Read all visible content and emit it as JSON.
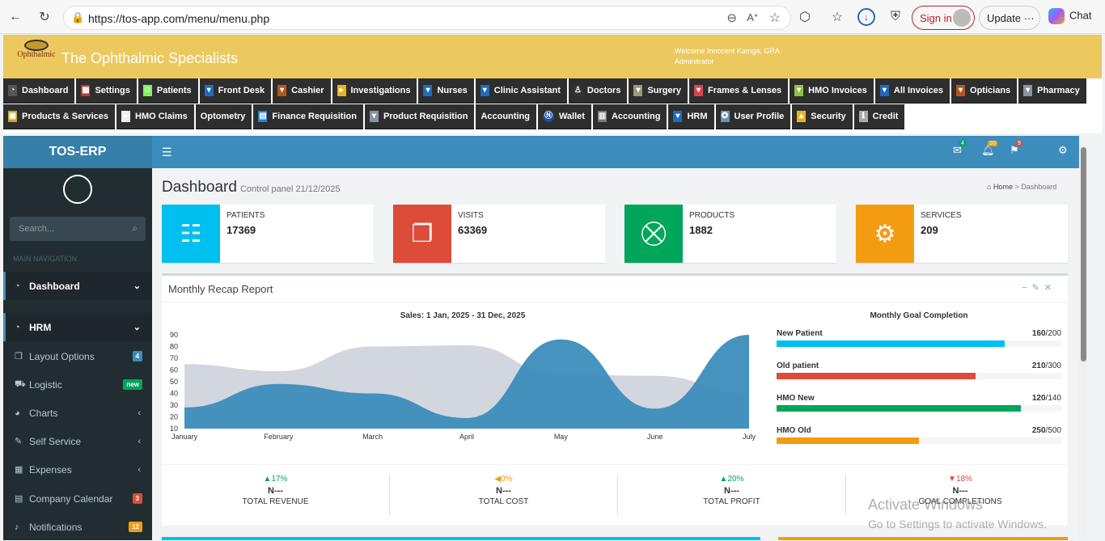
{
  "browser": {
    "url": "https://tos-app.com/menu/menu.php",
    "sign_in": "Sign in",
    "update": "Update",
    "chat": "Chat"
  },
  "header": {
    "clinic_name": "The Ophthalmic Specialists",
    "logo_line1": "The",
    "logo_line2": "Ophthalmic",
    "logo_line3": "Specialists",
    "welcome": "Welcome Innocent Kamga, GRA",
    "role": "Adminitrator"
  },
  "menu_row1": [
    {
      "label": "Dashboard",
      "icon": "tachometer-icon",
      "color": "#555"
    },
    {
      "label": "Settings",
      "icon": "grid-icon",
      "color": "#c0392b"
    },
    {
      "label": "Patients",
      "icon": "users-icon",
      "color": "#8e6"
    },
    {
      "label": "Front Desk",
      "icon": "dropdown-icon",
      "color": "#1e6bbf"
    },
    {
      "label": "Cashier",
      "icon": "dropdown-icon",
      "color": "#b5561f"
    },
    {
      "label": "Investigations",
      "icon": "play-icon",
      "color": "#e6b422"
    },
    {
      "label": "Nurses",
      "icon": "dropdown-icon",
      "color": "#1e6bbf"
    },
    {
      "label": "Clinic Assistant",
      "icon": "dropdown-icon",
      "color": "#1e6bbf"
    },
    {
      "label": "Doctors",
      "icon": "doctor-icon",
      "color": "#333"
    },
    {
      "label": "Surgery",
      "icon": "dropdown-icon",
      "color": "#9a9a7a"
    },
    {
      "label": "Frames & Lenses",
      "icon": "dropdown-icon",
      "color": "#d9434f"
    },
    {
      "label": "HMO Invoices",
      "icon": "dropdown-icon",
      "color": "#8bc34a"
    },
    {
      "label": "All Invoices",
      "icon": "dropdown-icon",
      "color": "#1e6bbf"
    },
    {
      "label": "Opticians",
      "icon": "dropdown-icon",
      "color": "#b5561f"
    },
    {
      "label": "Pharmacy",
      "icon": "dropdown-icon",
      "color": "#8a93a5"
    }
  ],
  "menu_row2": [
    {
      "label": "Products & Services",
      "icon": "box-icon",
      "color": "#c9a227"
    },
    {
      "label": "HMO Claims",
      "icon": "play-icon",
      "color": "#eee"
    },
    {
      "label": "Optometry",
      "icon": "",
      "color": ""
    },
    {
      "label": "Finance Requisition",
      "icon": "finance-icon",
      "color": "#2d7dd2"
    },
    {
      "label": "Product Requisition",
      "icon": "dropdown-icon",
      "color": "#8a93a5"
    },
    {
      "label": "Accounting",
      "icon": "",
      "color": ""
    },
    {
      "label": "Wallet",
      "icon": "wallet-icon",
      "color": "#1e4fa0"
    },
    {
      "label": "Accounting",
      "icon": "ledger-icon",
      "color": "#777"
    },
    {
      "label": "HRM",
      "icon": "dropdown-icon",
      "color": "#1e6bbf"
    },
    {
      "label": "User Profile",
      "icon": "user-profile-icon",
      "color": "#6b8fbf"
    },
    {
      "label": "Security",
      "icon": "lock-icon",
      "color": "#e6b422"
    },
    {
      "label": "Credit",
      "icon": "info-icon",
      "color": "#aaa"
    }
  ],
  "sidebar": {
    "brand": "TOS-ERP",
    "search_placeholder": "Search...",
    "section": "MAIN NAVIGATION",
    "items": [
      {
        "label": "Dashboard",
        "badge": ""
      },
      {
        "label": "HRM",
        "badge": ""
      },
      {
        "label": "Layout Options",
        "badge": "4"
      },
      {
        "label": "Logistic",
        "badge": "new"
      },
      {
        "label": "Charts",
        "badge": ""
      },
      {
        "label": "Self Service",
        "badge": ""
      },
      {
        "label": "Expenses",
        "badge": ""
      },
      {
        "label": "Company Calendar",
        "badge": "3"
      },
      {
        "label": "Notifications",
        "badge": "12"
      }
    ]
  },
  "topnav": {
    "mail_count": "4",
    "bell_count": "10",
    "flag_count": "9"
  },
  "page": {
    "title": "Dashboard",
    "subtitle": "Control panel 21/12/2025",
    "crumb_home": "Home",
    "crumb_current": "Dashboard"
  },
  "infoboxes": [
    {
      "label": "PATIENTS",
      "value": "17369",
      "color": "#00c0ef",
      "icon": "patients-icon"
    },
    {
      "label": "VISITS",
      "value": "63369",
      "color": "#dd4b39",
      "icon": "files-icon"
    },
    {
      "label": "PRODUCTS",
      "value": "1882",
      "color": "#00a65a",
      "icon": "cart-icon"
    },
    {
      "label": "SERVICES",
      "value": "209",
      "color": "#f39c12",
      "icon": "gear-icon"
    }
  ],
  "recap": {
    "title": "Monthly Recap Report",
    "sales_title": "Sales: 1 Jan, 2025 - 31 Dec, 2025",
    "goal_title": "Monthly Goal Completion"
  },
  "chart_data": {
    "type": "area",
    "categories": [
      "January",
      "February",
      "March",
      "April",
      "May",
      "June",
      "July"
    ],
    "yticks": [
      10,
      20,
      30,
      40,
      50,
      60,
      70,
      80,
      90
    ],
    "ylim": [
      10,
      90
    ],
    "series": [
      {
        "values": [
          65,
          59,
          80,
          81,
          56,
          55,
          40
        ],
        "color": "#d2d6de"
      },
      {
        "values": [
          28,
          48,
          40,
          19,
          86,
          27,
          90
        ],
        "color": "#3c8dbc"
      }
    ]
  },
  "goals": [
    {
      "label": "New Patient",
      "value": "160",
      "total": "200",
      "fraction": 0.8,
      "color": "#00c0ef"
    },
    {
      "label": "Old patient",
      "value": "210",
      "total": "300",
      "fraction": 0.7,
      "color": "#dd4b39"
    },
    {
      "label": "HMO New",
      "value": "120",
      "total": "140",
      "fraction": 0.857,
      "color": "#00a65a"
    },
    {
      "label": "HMO Old",
      "value": "250",
      "total": "500",
      "fraction": 0.5,
      "color": "#f39c12"
    }
  ],
  "stats": [
    {
      "pct": "17%",
      "dir": "▲",
      "color": "#00a65a",
      "value": "N---",
      "label": "TOTAL REVENUE"
    },
    {
      "pct": "0%",
      "dir": "◀",
      "color": "#f39c12",
      "value": "N---",
      "label": "TOTAL COST"
    },
    {
      "pct": "20%",
      "dir": "▲",
      "color": "#00a65a",
      "value": "N---",
      "label": "TOTAL PROFIT"
    },
    {
      "pct": "18%",
      "dir": "▼",
      "color": "#dd4b39",
      "value": "N---",
      "label": "GOAL COMPLETIONS"
    }
  ],
  "watermark": {
    "line1": "Activate Windows",
    "line2": "Go to Settings to activate Windows."
  }
}
